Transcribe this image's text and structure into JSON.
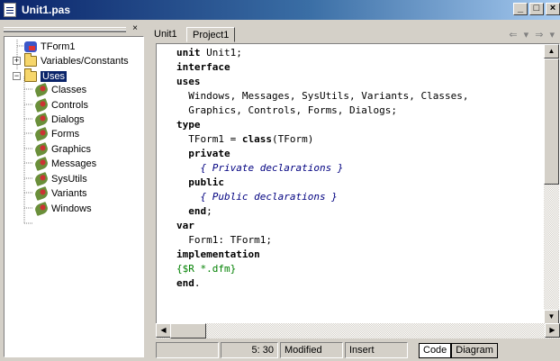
{
  "window": {
    "title": "Unit1.pas",
    "min_glyph": "_",
    "max_glyph": "□",
    "close_glyph": "×"
  },
  "tree": {
    "close_glyph": "×",
    "items": [
      {
        "label": "TForm1",
        "icon": "form-icon"
      },
      {
        "label": "Variables/Constants",
        "icon": "folder-icon",
        "expander": "+"
      },
      {
        "label": "Uses",
        "icon": "folder-icon",
        "expander": "−",
        "selected": true
      },
      {
        "label": "Classes",
        "icon": "unit-icon"
      },
      {
        "label": "Controls",
        "icon": "unit-icon"
      },
      {
        "label": "Dialogs",
        "icon": "unit-icon"
      },
      {
        "label": "Forms",
        "icon": "unit-icon"
      },
      {
        "label": "Graphics",
        "icon": "unit-icon"
      },
      {
        "label": "Messages",
        "icon": "unit-icon"
      },
      {
        "label": "SysUtils",
        "icon": "unit-icon"
      },
      {
        "label": "Variants",
        "icon": "unit-icon"
      },
      {
        "label": "Windows",
        "icon": "unit-icon"
      }
    ]
  },
  "tabs": [
    {
      "label": "Unit1"
    },
    {
      "label": "Project1"
    }
  ],
  "nav": {
    "arrows": "⇐ ▾ ⇒ ▾"
  },
  "code": {
    "lines": [
      [
        {
          "t": "unit",
          "c": "kw"
        },
        {
          "t": " Unit1;"
        }
      ],
      [
        {
          "t": "interface",
          "c": "kw"
        }
      ],
      [
        {
          "t": "uses",
          "c": "kw"
        }
      ],
      [
        {
          "t": "  Windows, Messages, SysUtils, Variants, Classes,"
        }
      ],
      [
        {
          "t": "  Graphics, Controls, Forms, Dialogs;"
        }
      ],
      [
        {
          "t": "type",
          "c": "kw"
        }
      ],
      [
        {
          "t": "  TForm1 = "
        },
        {
          "t": "class",
          "c": "kw"
        },
        {
          "t": "(TForm)"
        }
      ],
      [
        {
          "t": "  "
        },
        {
          "t": "private",
          "c": "kw"
        }
      ],
      [
        {
          "t": "    { Private declarations }",
          "c": "cm"
        }
      ],
      [
        {
          "t": "  "
        },
        {
          "t": "public",
          "c": "kw"
        }
      ],
      [
        {
          "t": "    { Public declarations }",
          "c": "cm"
        }
      ],
      [
        {
          "t": "  "
        },
        {
          "t": "end",
          "c": "kw"
        },
        {
          "t": ";"
        }
      ],
      [
        {
          "t": "var",
          "c": "kw"
        }
      ],
      [
        {
          "t": "  Form1: TForm1;"
        }
      ],
      [
        {
          "t": "implementation",
          "c": "kw"
        }
      ],
      [
        {
          "t": "{$R *.dfm}",
          "c": "dir"
        }
      ],
      [
        {
          "t": "end",
          "c": "kw"
        },
        {
          "t": "."
        }
      ]
    ]
  },
  "scrollbar": {
    "up": "▲",
    "down": "▼",
    "left": "◀",
    "right": "▶"
  },
  "status": {
    "position": "5: 30",
    "modified": "Modified",
    "insert": "Insert",
    "tab_code": "Code",
    "tab_diagram": "Diagram"
  }
}
